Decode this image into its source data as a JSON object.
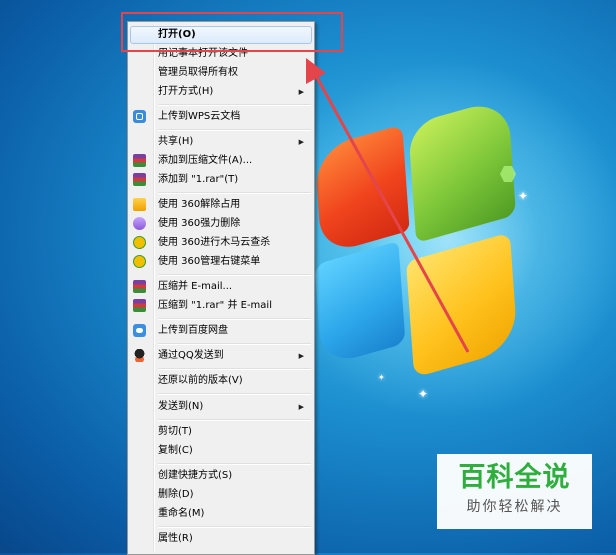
{
  "menu": {
    "items": [
      {
        "label": "打开(O)",
        "icon": "",
        "submenu": false,
        "bold": true,
        "highlighted": true
      },
      {
        "label": "用记事本打开该文件",
        "icon": "",
        "submenu": false
      },
      {
        "label": "管理员取得所有权",
        "icon": "",
        "submenu": false
      },
      {
        "label": "打开方式(H)",
        "icon": "",
        "submenu": true
      },
      {
        "label": "上传到WPS云文档",
        "icon": "wps-cloud-icon",
        "submenu": false
      },
      {
        "label": "共享(H)",
        "icon": "",
        "submenu": true
      },
      {
        "label": "添加到压缩文件(A)...",
        "icon": "winrar-icon",
        "submenu": false
      },
      {
        "label": "添加到 \"1.rar\"(T)",
        "icon": "winrar-icon",
        "submenu": false
      },
      {
        "label": "使用 360解除占用",
        "icon": "360-unlock-icon",
        "submenu": false
      },
      {
        "label": "使用 360强力删除",
        "icon": "360-delete-icon",
        "submenu": false
      },
      {
        "label": "使用 360进行木马云查杀",
        "icon": "360-scan-icon",
        "submenu": false
      },
      {
        "label": "使用 360管理右键菜单",
        "icon": "360-scan-icon",
        "submenu": false
      },
      {
        "label": "压缩并 E-mail...",
        "icon": "winrar-icon",
        "submenu": false
      },
      {
        "label": "压缩到 \"1.rar\" 并 E-mail",
        "icon": "winrar-icon",
        "submenu": false
      },
      {
        "label": "上传到百度网盘",
        "icon": "baidu-netdisk-icon",
        "submenu": false
      },
      {
        "label": "通过QQ发送到",
        "icon": "qq-icon",
        "submenu": true
      },
      {
        "label": "还原以前的版本(V)",
        "icon": "",
        "submenu": false
      },
      {
        "label": "发送到(N)",
        "icon": "",
        "submenu": true
      },
      {
        "label": "剪切(T)",
        "icon": "",
        "submenu": false
      },
      {
        "label": "复制(C)",
        "icon": "",
        "submenu": false
      },
      {
        "label": "创建快捷方式(S)",
        "icon": "",
        "submenu": false
      },
      {
        "label": "删除(D)",
        "icon": "",
        "submenu": false
      },
      {
        "label": "重命名(M)",
        "icon": "",
        "submenu": false
      },
      {
        "label": "属性(R)",
        "icon": "",
        "submenu": false
      }
    ]
  },
  "submenu_arrow": "▶",
  "annotation": {
    "highlight_color": "#e3454b"
  },
  "watermark": {
    "title": "百科全说",
    "subtitle": "助你轻松解决",
    "color": "#2fae3e"
  }
}
